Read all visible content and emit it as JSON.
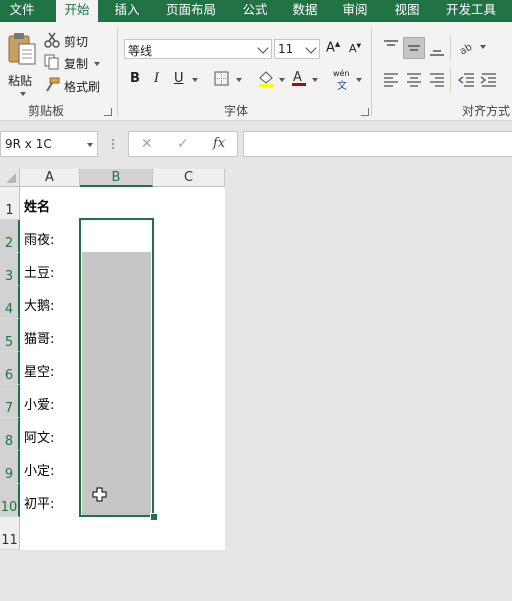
{
  "tabs": [
    "文件",
    "开始",
    "插入",
    "页面布局",
    "公式",
    "数据",
    "审阅",
    "视图",
    "开发工具"
  ],
  "clipboard": {
    "paste_label": "粘贴",
    "cut_label": "剪切",
    "copy_label": "复制",
    "format_painter_label": "格式刷",
    "group_label": "剪贴板"
  },
  "font": {
    "font_name": "等线",
    "font_size": "11",
    "bold_label": "B",
    "italic_label": "I",
    "underline_label": "U",
    "grow_label": "A",
    "shrink_label": "A",
    "phonetic_label": "wén",
    "phonetic_sub": "文",
    "group_label": "字体"
  },
  "alignment": {
    "group_label": "对齐方式"
  },
  "formula_bar": {
    "name_box": "9R x 1C",
    "cancel": "✕",
    "enter": "✓",
    "fx": "fx",
    "content": ""
  },
  "columns": [
    "A",
    "B",
    "C"
  ],
  "rows": [
    "1",
    "2",
    "3",
    "4",
    "5",
    "6",
    "7",
    "8",
    "9",
    "10",
    "11"
  ],
  "cells": {
    "header": "姓名",
    "names": [
      "雨夜:",
      "土豆:",
      "大鹅:",
      "猫哥:",
      "星空:",
      "小爱:",
      "阿文:",
      "小定:",
      "初平:"
    ]
  },
  "colors": {
    "accent": "#217346",
    "selection_fill": "#c6c6c6",
    "sheet_bg": "#ffffff",
    "app_bg": "#e6e6e6"
  },
  "icons": [
    "paste-icon",
    "scissors-icon",
    "copy-icon",
    "format-painter-icon",
    "border-icon",
    "fill-color-icon",
    "font-color-icon",
    "align-icon",
    "orientation-icon",
    "indent-icon",
    "fill-cross-cursor-icon"
  ]
}
